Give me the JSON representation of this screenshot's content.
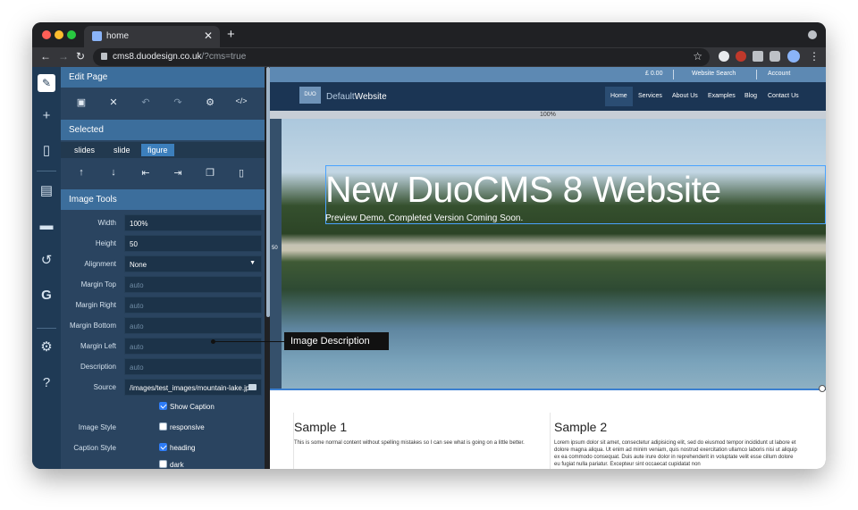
{
  "browser": {
    "tab_title": "home",
    "tab_close": "✕",
    "new_tab": "+",
    "url_host": "cms8.duodesign.co.uk",
    "url_path": "/?cms=true"
  },
  "editor": {
    "edit_page": "Edit Page",
    "selected": "Selected",
    "breadcrumbs": [
      "slides",
      "slide",
      "figure"
    ],
    "image_tools": "Image Tools",
    "fields": [
      {
        "label": "Width",
        "value": "100%",
        "placeholder": false
      },
      {
        "label": "Height",
        "value": "50",
        "placeholder": false
      },
      {
        "label": "Alignment",
        "value": "None",
        "placeholder": false
      },
      {
        "label": "Margin Top",
        "value": "auto",
        "placeholder": true
      },
      {
        "label": "Margin Right",
        "value": "auto",
        "placeholder": true
      },
      {
        "label": "Margin Bottom",
        "value": "auto",
        "placeholder": true
      },
      {
        "label": "Margin Left",
        "value": "auto",
        "placeholder": true
      },
      {
        "label": "Description",
        "value": "auto",
        "placeholder": true
      },
      {
        "label": "Source",
        "value": "/images/test_images/mountain-lake.jp",
        "placeholder": false
      }
    ],
    "show_caption": "Show Caption",
    "image_style_label": "Image Style",
    "image_style_option": "responsive",
    "caption_style_label": "Caption Style",
    "caption_option_1": "heading",
    "caption_option_2": "dark"
  },
  "website": {
    "topbar": [
      "£ 0.00",
      "Website Search",
      "Account"
    ],
    "logo_box": "DUO",
    "logo_light": "Default",
    "logo_bold": "Website",
    "nav": [
      "Home",
      "Services",
      "About Us",
      "Examples",
      "Blog",
      "Contact Us"
    ],
    "percent": "100%",
    "side_label": "50",
    "hero_title": "New DuoCMS 8 Website",
    "hero_subtitle": "Preview Demo, Completed Version Coming Soon.",
    "sample1_title": "Sample 1",
    "sample1_text": "This is some normal content without spelling mistakes so I can see what is going on a little better.",
    "sample2_title": "Sample 2",
    "sample2_text": "Lorem ipsum dolor sit amet, consectetur adipisicing elit, sed do eiusmod tempor incididunt ut labore et dolore magna aliqua. Ut enim ad minim veniam, quis nostrud exercitation ullamco laboris nisi ut aliquip ex ea commodo consequat. Duis aute irure dolor in reprehenderit in voluptate velit esse cillum dolore eu fugiat nulla pariatur. Excepteur sint occaecat cupidatat non"
  },
  "annotation": {
    "label": "Image Description"
  }
}
